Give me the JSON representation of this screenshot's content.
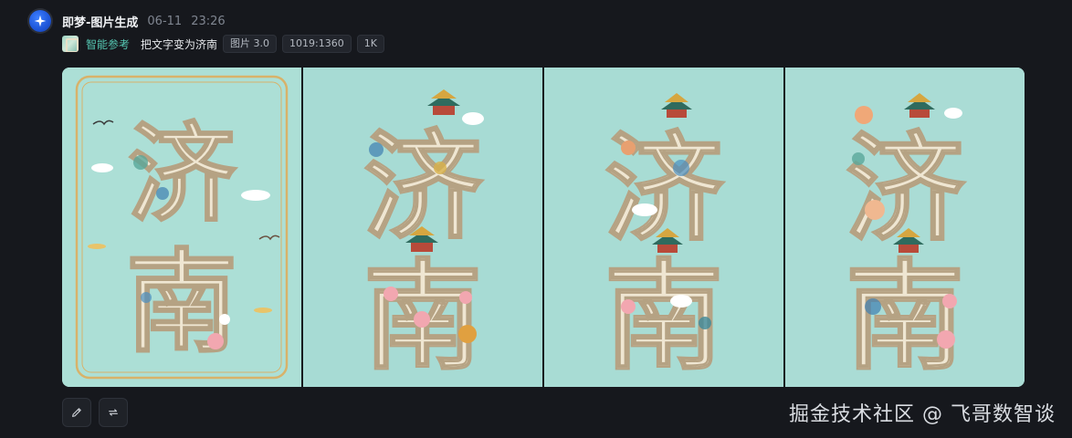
{
  "header": {
    "avatar_icon": "sparkle-star-icon",
    "app_name": "即梦-图片生成",
    "date": "06-11",
    "time": "23:26"
  },
  "info": {
    "reference_label": "智能参考",
    "prompt": "把文字变为济南",
    "tags": [
      "图片 3.0",
      "1019:1360",
      "1K"
    ]
  },
  "gallery": {
    "images": [
      {
        "char_top": "济",
        "char_bottom": "南"
      },
      {
        "char_top": "济",
        "char_bottom": "南"
      },
      {
        "char_top": "济",
        "char_bottom": "南"
      },
      {
        "char_top": "济",
        "char_bottom": "南"
      }
    ]
  },
  "actions": {
    "edit_icon": "pencil-icon",
    "regenerate_icon": "repeat-icon"
  },
  "watermark": "掘金技术社区 @ 飞哥数智谈",
  "colors": {
    "background": "#16181d",
    "accent": "#55c7b2",
    "image_bg": "#a9dcd3",
    "glyph_fill": "#efe6d2"
  }
}
